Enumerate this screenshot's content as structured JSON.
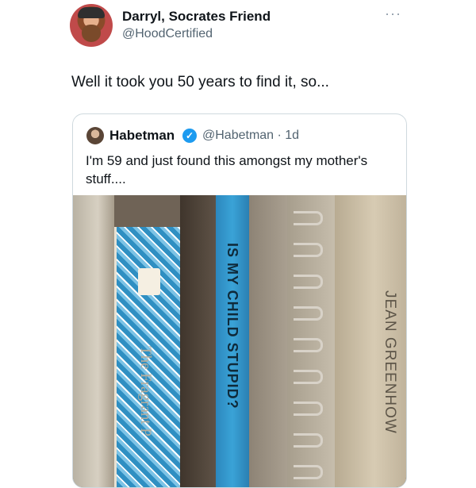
{
  "post": {
    "author_name": "Darryl, Socrates Friend",
    "author_handle": "@HoodCertified",
    "more_icon": "more-horizontal-icon",
    "text": "Well it took you 50 years to find it, so..."
  },
  "quoted": {
    "author_name": "Habetman",
    "verified_icon": "verified-badge-icon",
    "handle_time": "@Habetman · 1d",
    "text": "I'm 59 and just found this amongst my mother's stuff...."
  },
  "photo": {
    "books": [
      {
        "label": "IS MY CHILD STUPID?"
      },
      {
        "label": "JEAN GREENHOW"
      },
      {
        "label": "The Fragrant P"
      }
    ]
  },
  "colors": {
    "verified": "#1d9bf0",
    "handle_gray": "#536471",
    "border": "#cfd9de",
    "book_blue": "#3aa3d7"
  }
}
